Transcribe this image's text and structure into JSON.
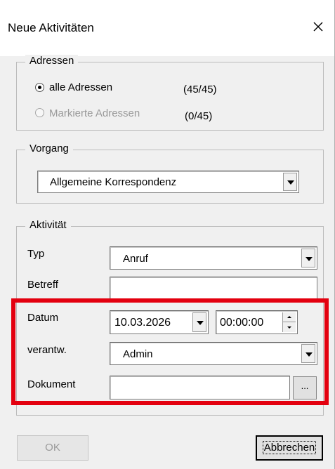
{
  "window": {
    "title": "Neue Aktivitäten",
    "close_icon": "close-icon"
  },
  "addresses": {
    "legend": "Adressen",
    "options": [
      {
        "label": "alle Adressen",
        "count": "(45/45)",
        "checked": true,
        "enabled": true
      },
      {
        "label": "Markierte Adressen",
        "count": "(0/45)",
        "checked": false,
        "enabled": false
      }
    ]
  },
  "process": {
    "legend": "Vorgang",
    "selected": "Allgemeine Korrespondenz"
  },
  "activity": {
    "legend": "Aktivität",
    "type_label": "Typ",
    "type_value": "Anruf",
    "subject_label": "Betreff",
    "subject_value": "",
    "date_label": "Datum",
    "date_value": "10.03.2026",
    "time_value": "00:00:00",
    "responsible_label": "verantw.",
    "responsible_value": "Admin",
    "document_label": "Dokument",
    "document_value": "",
    "browse_label": "..."
  },
  "buttons": {
    "ok": "OK",
    "cancel": "Abbrechen"
  },
  "colors": {
    "highlight": "#e3000f",
    "dialog_bg": "#f0f0f0"
  }
}
